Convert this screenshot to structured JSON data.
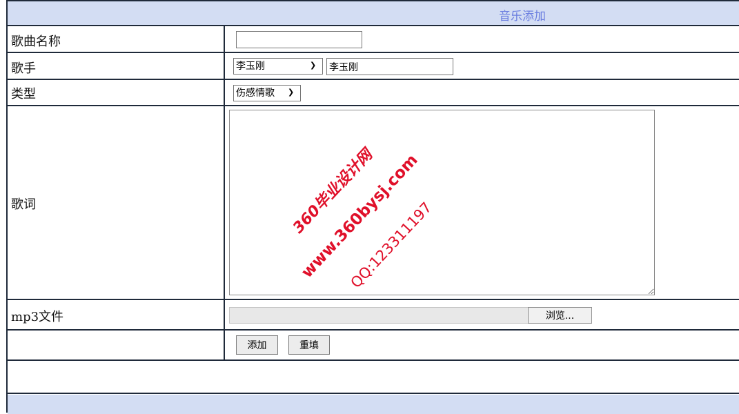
{
  "header": {
    "title": "音乐添加"
  },
  "form": {
    "song_name": {
      "label": "歌曲名称",
      "value": ""
    },
    "singer": {
      "label": "歌手",
      "selected": "李玉刚",
      "text_value": "李玉刚"
    },
    "type": {
      "label": "类型",
      "selected": "伤感情歌"
    },
    "lyrics": {
      "label": "歌词",
      "value": ""
    },
    "mp3": {
      "label": "mp3文件",
      "browse_label": "浏览..."
    },
    "actions": {
      "add_label": "添加",
      "reset_label": "重填"
    }
  },
  "watermark": {
    "line1": "360毕业设计网",
    "line2": "www.360bysj.com",
    "line3": "QQ:123311197"
  },
  "colors": {
    "header_bg": "#d3ddf3",
    "header_text": "#6c7fe0",
    "border": "#1f2a3a",
    "watermark": "#e0102a"
  }
}
